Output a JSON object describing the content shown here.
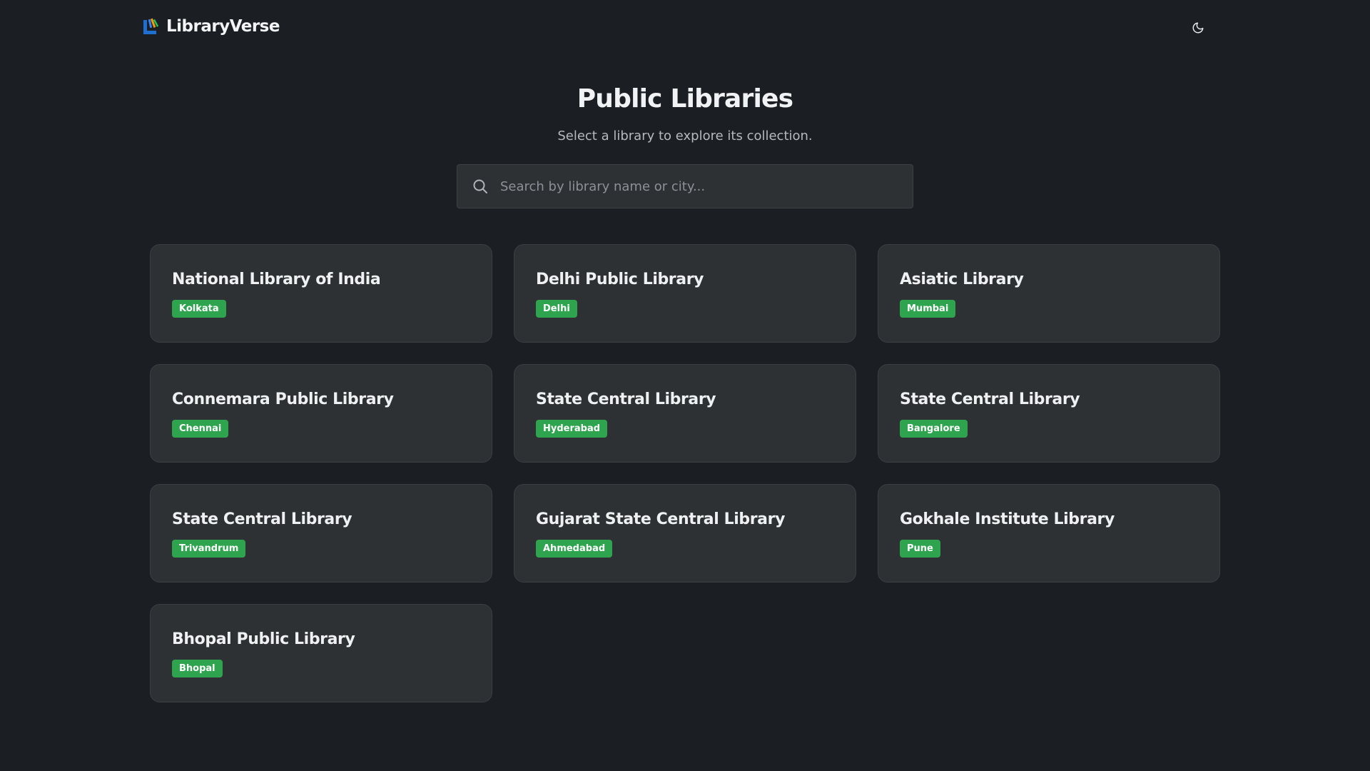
{
  "header": {
    "logo_text": "LibraryVerse",
    "logo_icon": "library-logo-icon",
    "theme_toggle_icon": "moon-icon"
  },
  "hero": {
    "title": "Public Libraries",
    "subtitle": "Select a library to explore its collection."
  },
  "search": {
    "icon": "search-icon",
    "placeholder": "Search by library name or city..."
  },
  "libraries": [
    {
      "name": "National Library of India",
      "city": "Kolkata"
    },
    {
      "name": "Delhi Public Library",
      "city": "Delhi"
    },
    {
      "name": "Asiatic Library",
      "city": "Mumbai"
    },
    {
      "name": "Connemara Public Library",
      "city": "Chennai"
    },
    {
      "name": "State Central Library",
      "city": "Hyderabad"
    },
    {
      "name": "State Central Library",
      "city": "Bangalore"
    },
    {
      "name": "State Central Library",
      "city": "Trivandrum"
    },
    {
      "name": "Gujarat State Central Library",
      "city": "Ahmedabad"
    },
    {
      "name": "Gokhale Institute Library",
      "city": "Pune"
    },
    {
      "name": "Bhopal Public Library",
      "city": "Bhopal"
    }
  ],
  "colors": {
    "background": "#1b1e23",
    "card": "#2e3134",
    "badge": "#2ea44f",
    "logo_blue": "#1f6fd1"
  }
}
